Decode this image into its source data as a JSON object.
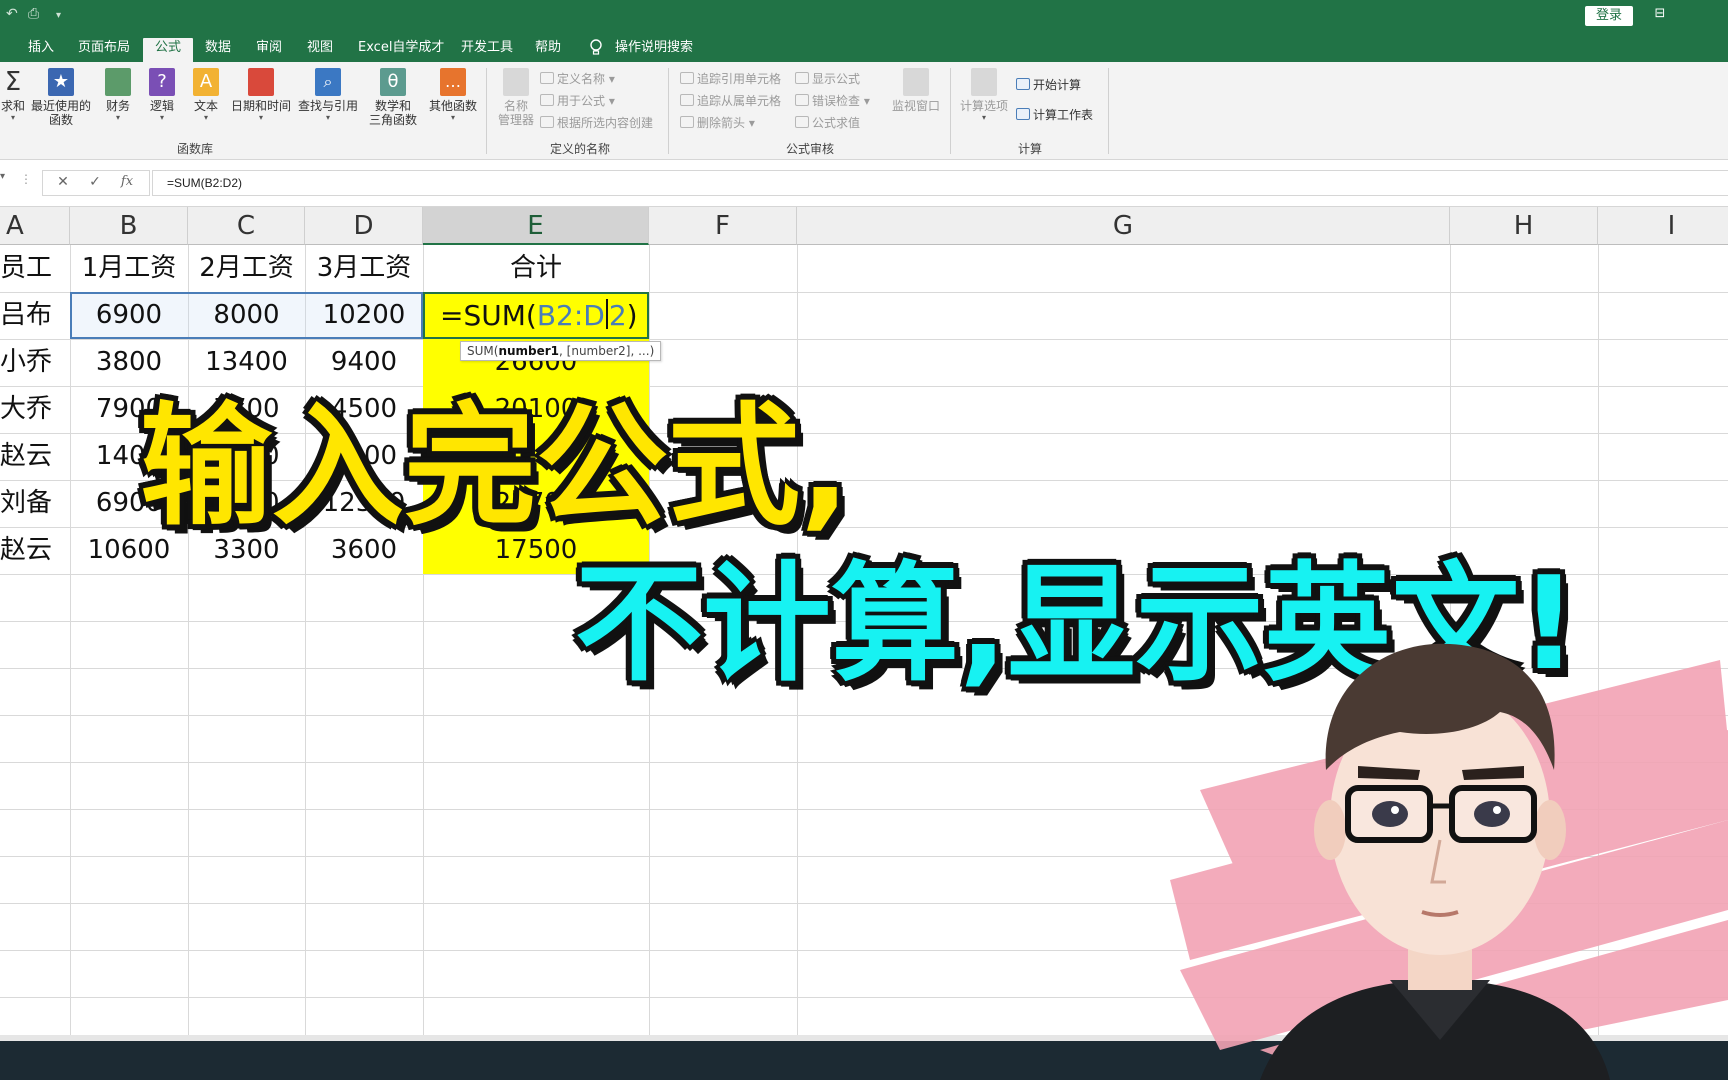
{
  "titlebar": {
    "login_label": "登录"
  },
  "tabs": [
    "插入",
    "页面布局",
    "公式",
    "数据",
    "审阅",
    "视图",
    "Excel自学成才",
    "开发工具",
    "帮助"
  ],
  "active_tab": "公式",
  "tell_me": "操作说明搜索",
  "ribbon": {
    "function_library": {
      "label": "函数库",
      "buttons": [
        {
          "label": "求和",
          "icon": "autosum-icon"
        },
        {
          "label": "最近使用的函数",
          "line1": "最近使用的",
          "line2": "函数",
          "icon": "star-icon"
        },
        {
          "label": "财务",
          "icon": "finance-icon"
        },
        {
          "label": "逻辑",
          "icon": "logic-icon"
        },
        {
          "label": "文本",
          "icon": "text-icon"
        },
        {
          "label": "日期和时间",
          "icon": "calendar-icon"
        },
        {
          "label": "查找与引用",
          "icon": "lookup-icon"
        },
        {
          "label": "数学和三角函数",
          "line1": "数学和",
          "line2": "三角函数",
          "icon": "theta-icon"
        },
        {
          "label": "其他函数",
          "icon": "more-functions-icon"
        }
      ]
    },
    "defined_names": {
      "label": "定义的名称",
      "manager_line1": "名称",
      "manager_line2": "管理器",
      "items": [
        "定义名称",
        "用于公式",
        "根据所选内容创建"
      ]
    },
    "formula_auditing": {
      "label": "公式审核",
      "items": [
        "追踪引用单元格",
        "追踪从属单元格",
        "删除箭头",
        "显示公式",
        "错误检查",
        "公式求值"
      ],
      "watch_window": "监视窗口"
    },
    "calculation": {
      "label": "计算",
      "options": "计算选项",
      "calc_now": "开始计算",
      "calc_sheet": "计算工作表"
    }
  },
  "formula_bar": {
    "cancel": "✕",
    "enter": "✓",
    "fx": "fx",
    "value": "=SUM(B2:D2)"
  },
  "columns": [
    "A",
    "B",
    "C",
    "D",
    "E",
    "F",
    "G",
    "H",
    "I"
  ],
  "selected_column": "E",
  "table": {
    "headers": [
      "员工",
      "1月工资",
      "2月工资",
      "3月工资",
      "合计"
    ],
    "rows": [
      [
        "吕布",
        "6900",
        "8000",
        "10200",
        ""
      ],
      [
        "小乔",
        "3800",
        "13400",
        "9400",
        "26600"
      ],
      [
        "大乔",
        "7900",
        "7700",
        "4500",
        "20100"
      ],
      [
        "赵云",
        "1400",
        "1800",
        "1500",
        "4700"
      ],
      [
        "刘备",
        "6900",
        "3500",
        "12300",
        "22700"
      ],
      [
        "赵云",
        "10600",
        "3300",
        "3600",
        "17500"
      ]
    ]
  },
  "active_cell": {
    "prefix": "=SUM(",
    "ref_a": "B2:D",
    "ref_b": "2",
    "suffix": ")"
  },
  "tooltip": {
    "fn": "SUM(",
    "arg1": "number1",
    "rest": ", [number2], ...)"
  },
  "captions": {
    "line1": "输入完公式,",
    "line2": "不计算,显示英文!"
  },
  "colors": {
    "excel_green": "#217346",
    "highlight_yellow": "#ffff00",
    "caption_yellow": "#ffe600",
    "caption_cyan": "#17f2f2",
    "ref_blue": "#4a7db8"
  }
}
